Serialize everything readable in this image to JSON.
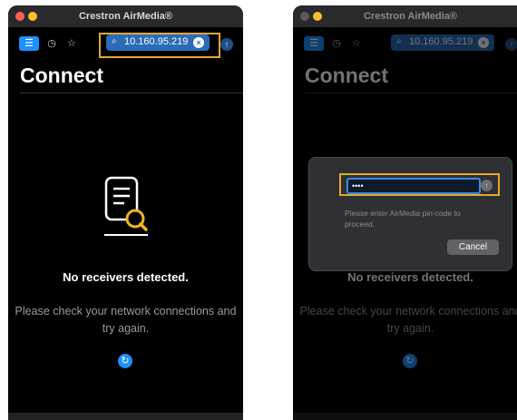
{
  "app": {
    "title": "Crestron AirMedia®"
  },
  "toolbar": {
    "list_icon": "list-icon",
    "history_icon": "clock-icon",
    "favorites_icon": "star-icon",
    "search_value": "10.160.95.219",
    "clear_icon": "clear-icon",
    "go_icon": "arrow-up-icon"
  },
  "main": {
    "heading": "Connect",
    "empty_title": "No receivers detected.",
    "empty_message": "Please check your network connections and try again.",
    "refresh_icon": "refresh-icon"
  },
  "dialog": {
    "pin_value": "••••",
    "hint": "Please enter AirMedia pin-code to proceed.",
    "cancel_label": "Cancel"
  },
  "colors": {
    "accent": "#1e90ff",
    "highlight": "#e5a92a",
    "background": "#000000"
  }
}
